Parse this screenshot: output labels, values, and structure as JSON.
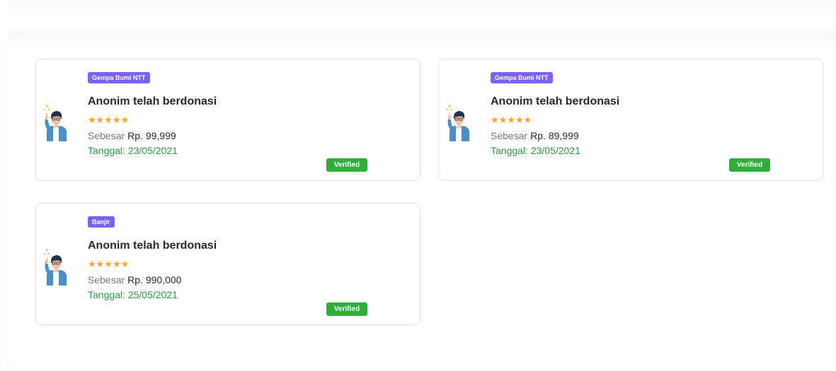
{
  "donations": [
    {
      "category": "Gempa Bumi NTT",
      "title": "Anonim telah berdonasi",
      "rating": 5,
      "stars": "★★★★★",
      "amount_label": "Sebesar",
      "amount_value": "Rp. 99,999",
      "date": "Tanggal: 23/05/2021",
      "status": "Verified"
    },
    {
      "category": "Gempa Bumi NTT",
      "title": "Anonim telah berdonasi",
      "rating": 5,
      "stars": "★★★★★",
      "amount_label": "Sebesar",
      "amount_value": "Rp. 89,999",
      "date": "Tanggal: 23/05/2021",
      "status": "Verified"
    },
    {
      "category": "Banjir",
      "title": "Anonim telah berdonasi",
      "rating": 5,
      "stars": "★★★★★",
      "amount_label": "Sebesar",
      "amount_value": "Rp. 990,000",
      "date": "Tanggal: 25/05/2021",
      "status": "Verified"
    }
  ],
  "colors": {
    "badge": "#7b61ff",
    "star": "#f6a623",
    "date": "#2e9b45",
    "verified": "#2fae3c"
  },
  "icons": {
    "avatar": "donor-avatar-icon",
    "star": "star-icon"
  }
}
